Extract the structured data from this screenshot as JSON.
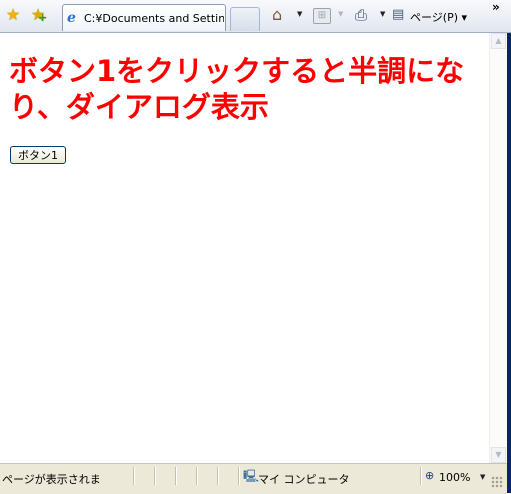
{
  "toolbar": {
    "favorites_icon": "star-icon",
    "add_favorite_icon": "add-favorite-icon",
    "tab": {
      "icon": "ie-page-icon",
      "title": "C:¥Documents and Settin..."
    },
    "home_icon": "home-icon",
    "feeds_icon": "rss-feed-icon",
    "print_icon": "printer-icon",
    "page_icon": "page-icon",
    "page_menu_label": "ページ(P)",
    "more_icon": "chevron-double-right-icon"
  },
  "content": {
    "heading": "ボタン1をクリックすると半調になり、ダイアログ表示",
    "button_label": "ボタン1",
    "heading_color": "#ff0000"
  },
  "statusbar": {
    "status_text": "ページが表示されま",
    "zone_icon": "computer-zone-icon",
    "zone_label": "マイ コンピュータ",
    "zoom_icon": "zoom-magnifier-icon",
    "zoom_label": "100%"
  }
}
